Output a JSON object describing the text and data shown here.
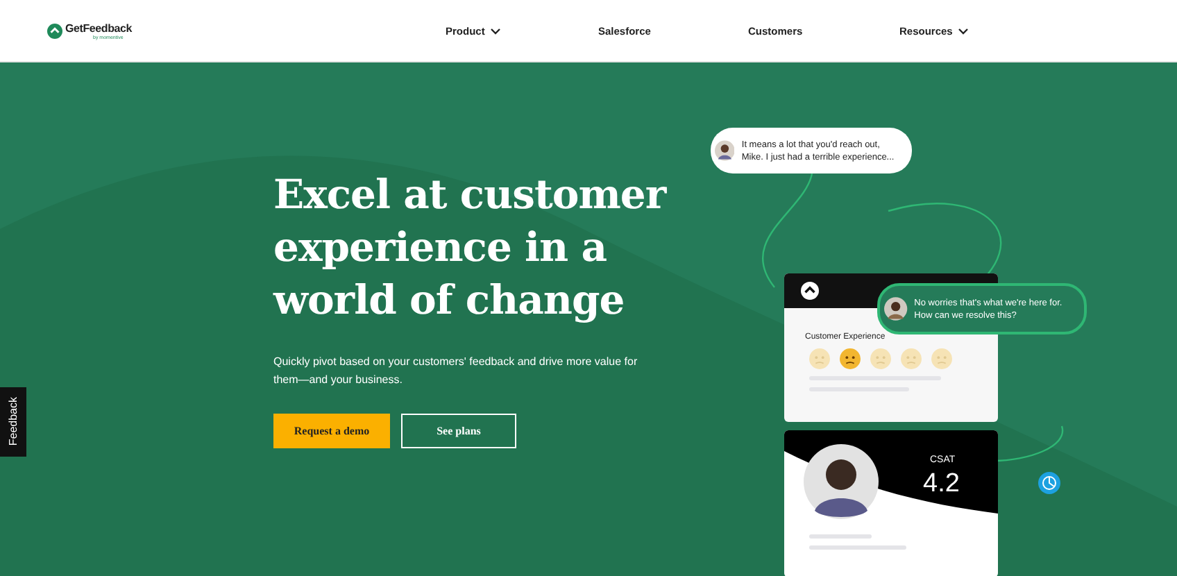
{
  "header": {
    "logo": {
      "name": "GetFeedback",
      "tagline": "by momentive"
    },
    "nav": [
      {
        "label": "Product",
        "has_menu": true
      },
      {
        "label": "Salesforce",
        "has_menu": false
      },
      {
        "label": "Customers",
        "has_menu": false
      },
      {
        "label": "Resources",
        "has_menu": true
      }
    ]
  },
  "feedback_tab": "Feedback",
  "hero": {
    "title": "Excel at customer experience in a world of change",
    "subtitle": "Quickly pivot based on your customers' feedback and drive more value for them—and your business.",
    "buttons": [
      {
        "label": "Request a demo",
        "kind": "primary"
      },
      {
        "label": "See plans",
        "kind": "outline"
      }
    ]
  },
  "illustration": {
    "bubbles": [
      "It means a lot that you'd reach out, Mike. I just had a terrible experience...",
      "No worries that's what we're here for. How can we resolve this?"
    ],
    "survey": {
      "title": "Customer Experience",
      "ratings": [
        {
          "selected": false
        },
        {
          "selected": true
        },
        {
          "selected": false
        },
        {
          "selected": false
        },
        {
          "selected": false
        }
      ]
    },
    "score": {
      "label": "CSAT",
      "value": "4.2"
    }
  }
}
